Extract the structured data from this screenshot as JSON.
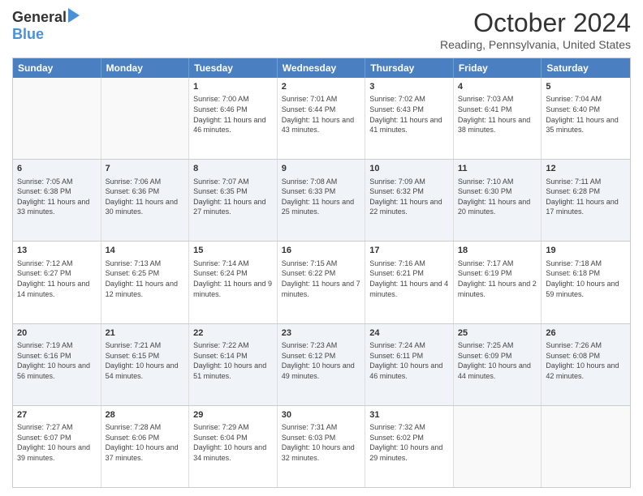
{
  "header": {
    "logo_general": "General",
    "logo_blue": "Blue",
    "month_title": "October 2024",
    "location": "Reading, Pennsylvania, United States"
  },
  "calendar": {
    "days_of_week": [
      "Sunday",
      "Monday",
      "Tuesday",
      "Wednesday",
      "Thursday",
      "Friday",
      "Saturday"
    ],
    "rows": [
      [
        {
          "day": "",
          "detail": ""
        },
        {
          "day": "",
          "detail": ""
        },
        {
          "day": "1",
          "detail": "Sunrise: 7:00 AM\nSunset: 6:46 PM\nDaylight: 11 hours and 46 minutes."
        },
        {
          "day": "2",
          "detail": "Sunrise: 7:01 AM\nSunset: 6:44 PM\nDaylight: 11 hours and 43 minutes."
        },
        {
          "day": "3",
          "detail": "Sunrise: 7:02 AM\nSunset: 6:43 PM\nDaylight: 11 hours and 41 minutes."
        },
        {
          "day": "4",
          "detail": "Sunrise: 7:03 AM\nSunset: 6:41 PM\nDaylight: 11 hours and 38 minutes."
        },
        {
          "day": "5",
          "detail": "Sunrise: 7:04 AM\nSunset: 6:40 PM\nDaylight: 11 hours and 35 minutes."
        }
      ],
      [
        {
          "day": "6",
          "detail": "Sunrise: 7:05 AM\nSunset: 6:38 PM\nDaylight: 11 hours and 33 minutes."
        },
        {
          "day": "7",
          "detail": "Sunrise: 7:06 AM\nSunset: 6:36 PM\nDaylight: 11 hours and 30 minutes."
        },
        {
          "day": "8",
          "detail": "Sunrise: 7:07 AM\nSunset: 6:35 PM\nDaylight: 11 hours and 27 minutes."
        },
        {
          "day": "9",
          "detail": "Sunrise: 7:08 AM\nSunset: 6:33 PM\nDaylight: 11 hours and 25 minutes."
        },
        {
          "day": "10",
          "detail": "Sunrise: 7:09 AM\nSunset: 6:32 PM\nDaylight: 11 hours and 22 minutes."
        },
        {
          "day": "11",
          "detail": "Sunrise: 7:10 AM\nSunset: 6:30 PM\nDaylight: 11 hours and 20 minutes."
        },
        {
          "day": "12",
          "detail": "Sunrise: 7:11 AM\nSunset: 6:28 PM\nDaylight: 11 hours and 17 minutes."
        }
      ],
      [
        {
          "day": "13",
          "detail": "Sunrise: 7:12 AM\nSunset: 6:27 PM\nDaylight: 11 hours and 14 minutes."
        },
        {
          "day": "14",
          "detail": "Sunrise: 7:13 AM\nSunset: 6:25 PM\nDaylight: 11 hours and 12 minutes."
        },
        {
          "day": "15",
          "detail": "Sunrise: 7:14 AM\nSunset: 6:24 PM\nDaylight: 11 hours and 9 minutes."
        },
        {
          "day": "16",
          "detail": "Sunrise: 7:15 AM\nSunset: 6:22 PM\nDaylight: 11 hours and 7 minutes."
        },
        {
          "day": "17",
          "detail": "Sunrise: 7:16 AM\nSunset: 6:21 PM\nDaylight: 11 hours and 4 minutes."
        },
        {
          "day": "18",
          "detail": "Sunrise: 7:17 AM\nSunset: 6:19 PM\nDaylight: 11 hours and 2 minutes."
        },
        {
          "day": "19",
          "detail": "Sunrise: 7:18 AM\nSunset: 6:18 PM\nDaylight: 10 hours and 59 minutes."
        }
      ],
      [
        {
          "day": "20",
          "detail": "Sunrise: 7:19 AM\nSunset: 6:16 PM\nDaylight: 10 hours and 56 minutes."
        },
        {
          "day": "21",
          "detail": "Sunrise: 7:21 AM\nSunset: 6:15 PM\nDaylight: 10 hours and 54 minutes."
        },
        {
          "day": "22",
          "detail": "Sunrise: 7:22 AM\nSunset: 6:14 PM\nDaylight: 10 hours and 51 minutes."
        },
        {
          "day": "23",
          "detail": "Sunrise: 7:23 AM\nSunset: 6:12 PM\nDaylight: 10 hours and 49 minutes."
        },
        {
          "day": "24",
          "detail": "Sunrise: 7:24 AM\nSunset: 6:11 PM\nDaylight: 10 hours and 46 minutes."
        },
        {
          "day": "25",
          "detail": "Sunrise: 7:25 AM\nSunset: 6:09 PM\nDaylight: 10 hours and 44 minutes."
        },
        {
          "day": "26",
          "detail": "Sunrise: 7:26 AM\nSunset: 6:08 PM\nDaylight: 10 hours and 42 minutes."
        }
      ],
      [
        {
          "day": "27",
          "detail": "Sunrise: 7:27 AM\nSunset: 6:07 PM\nDaylight: 10 hours and 39 minutes."
        },
        {
          "day": "28",
          "detail": "Sunrise: 7:28 AM\nSunset: 6:06 PM\nDaylight: 10 hours and 37 minutes."
        },
        {
          "day": "29",
          "detail": "Sunrise: 7:29 AM\nSunset: 6:04 PM\nDaylight: 10 hours and 34 minutes."
        },
        {
          "day": "30",
          "detail": "Sunrise: 7:31 AM\nSunset: 6:03 PM\nDaylight: 10 hours and 32 minutes."
        },
        {
          "day": "31",
          "detail": "Sunrise: 7:32 AM\nSunset: 6:02 PM\nDaylight: 10 hours and 29 minutes."
        },
        {
          "day": "",
          "detail": ""
        },
        {
          "day": "",
          "detail": ""
        }
      ]
    ]
  }
}
